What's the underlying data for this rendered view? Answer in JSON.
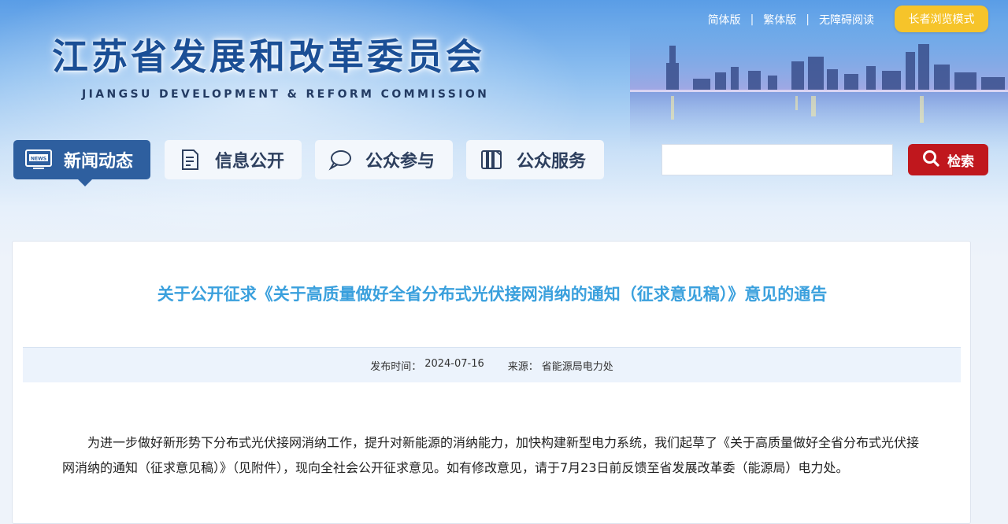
{
  "header": {
    "title": "江苏省发展和改革委员会",
    "subtitle": "JIANGSU DEVELOPMENT & REFORM COMMISSION"
  },
  "toplinks": {
    "simplified": "简体版",
    "traditional": "繁体版",
    "accessible": "无障碍阅读",
    "separator": "|",
    "elder_mode": "长者浏览模式"
  },
  "nav": {
    "items": [
      {
        "label": "新闻动态",
        "icon": "news-icon"
      },
      {
        "label": "信息公开",
        "icon": "document-icon"
      },
      {
        "label": "公众参与",
        "icon": "chat-bubble-icon"
      },
      {
        "label": "公众服务",
        "icon": "book-icon"
      }
    ],
    "active_index": 0
  },
  "search": {
    "value": "",
    "placeholder": "",
    "button_label": "检索"
  },
  "article": {
    "title": "关于公开征求《关于高质量做好全省分布式光伏接网消纳的通知（征求意见稿）》意见的通告",
    "publish_label": "发布时间：",
    "publish_date": "2024-07-16",
    "source_label": "来源：",
    "source": "省能源局电力处",
    "paragraph": "为进一步做好新形势下分布式光伏接网消纳工作，提升对新能源的消纳能力，加快构建新型电力系统，我们起草了《关于高质量做好全省分布式光伏接网消纳的通知（征求意见稿）》（见附件），现向全社会公开征求意见。如有修改意见，请于7月23日前反馈至省发展改革委（能源局）电力处。"
  },
  "colors": {
    "accent_blue": "#2e5f9f",
    "title_blue": "#3aa0dd",
    "search_red": "#c0171d",
    "elder_yellow": "#f6c42a"
  }
}
